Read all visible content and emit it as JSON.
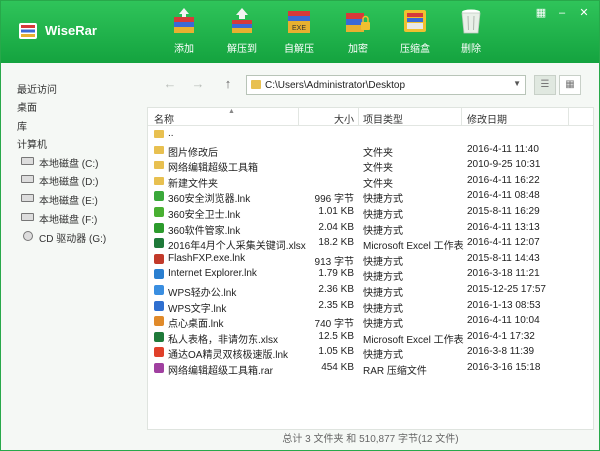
{
  "app": {
    "title": "WiseRar"
  },
  "toolbar": {
    "add": "添加",
    "extract_to": "解压到",
    "self_extract": "自解压",
    "encrypt": "加密",
    "compress_box": "压缩盒",
    "delete": "删除",
    "exe_badge": "EXE"
  },
  "sidebar": {
    "recent": "最近访问",
    "desktop": "桌面",
    "library": "库",
    "computer": "计算机",
    "drives": [
      "本地磁盘 (C:)",
      "本地磁盘 (D:)",
      "本地磁盘 (E:)",
      "本地磁盘 (F:)",
      "CD 驱动器 (G:)"
    ]
  },
  "address": {
    "path": "C:\\Users\\Administrator\\Desktop"
  },
  "columns": {
    "name": "名称",
    "size": "大小",
    "type": "项目类型",
    "modified": "修改日期"
  },
  "files": [
    {
      "name": "..",
      "size": "",
      "type": "",
      "modified": "",
      "icon": "folder",
      "color": "#e8c050"
    },
    {
      "name": "图片修改后",
      "size": "",
      "type": "文件夹",
      "modified": "2016-4-11 11:40",
      "icon": "folder",
      "color": "#e8c050"
    },
    {
      "name": "网络编辑超级工具箱",
      "size": "",
      "type": "文件夹",
      "modified": "2010-9-25 10:31",
      "icon": "folder",
      "color": "#e8c050"
    },
    {
      "name": "新建文件夹",
      "size": "",
      "type": "文件夹",
      "modified": "2016-4-11 16:22",
      "icon": "folder",
      "color": "#e8c050"
    },
    {
      "name": "360安全浏览器.lnk",
      "size": "996 字节",
      "type": "快捷方式",
      "modified": "2016-4-11 08:48",
      "icon": "browser-360",
      "color": "#3aa83a"
    },
    {
      "name": "360安全卫士.lnk",
      "size": "1.01 KB",
      "type": "快捷方式",
      "modified": "2015-8-11 16:29",
      "icon": "guard-360",
      "color": "#49b032"
    },
    {
      "name": "360软件管家.lnk",
      "size": "2.04 KB",
      "type": "快捷方式",
      "modified": "2016-4-11 13:13",
      "icon": "softmgr-360",
      "color": "#2c9b2c"
    },
    {
      "name": "2016年4月个人采集关键词.xlsx",
      "size": "18.2 KB",
      "type": "Microsoft Excel 工作表",
      "modified": "2016-4-11 12:07",
      "icon": "excel",
      "color": "#1f7a3a"
    },
    {
      "name": "FlashFXP.exe.lnk",
      "size": "913 字节",
      "type": "快捷方式",
      "modified": "2015-8-11 14:43",
      "icon": "flashfxp",
      "color": "#c23a2a"
    },
    {
      "name": "Internet Explorer.lnk",
      "size": "1.79 KB",
      "type": "快捷方式",
      "modified": "2016-3-18 11:21",
      "icon": "ie",
      "color": "#2a7fd0"
    },
    {
      "name": "WPS轻办公.lnk",
      "size": "2.36 KB",
      "type": "快捷方式",
      "modified": "2015-12-25 17:57",
      "icon": "wps-office",
      "color": "#3a8ee0"
    },
    {
      "name": "WPS文字.lnk",
      "size": "2.35 KB",
      "type": "快捷方式",
      "modified": "2016-1-13 08:53",
      "icon": "wps-writer",
      "color": "#2f6fd0"
    },
    {
      "name": "点心桌面.lnk",
      "size": "740 字节",
      "type": "快捷方式",
      "modified": "2016-4-11 10:04",
      "icon": "dianxin",
      "color": "#e08a2a"
    },
    {
      "name": "私人表格，非请勿东.xlsx",
      "size": "12.5 KB",
      "type": "Microsoft Excel 工作表",
      "modified": "2016-4-1 17:32",
      "icon": "excel",
      "color": "#1f7a3a"
    },
    {
      "name": "通达OA精灵双核极速版.lnk",
      "size": "1.05 KB",
      "type": "快捷方式",
      "modified": "2016-3-8 11:39",
      "icon": "oa",
      "color": "#e0402a"
    },
    {
      "name": "网络编辑超级工具箱.rar",
      "size": "454 KB",
      "type": "RAR 压缩文件",
      "modified": "2016-3-16 15:18",
      "icon": "rar",
      "color": "#a040a0"
    }
  ],
  "status": "总计 3 文件夹  和  510,877 字节(12 文件)"
}
